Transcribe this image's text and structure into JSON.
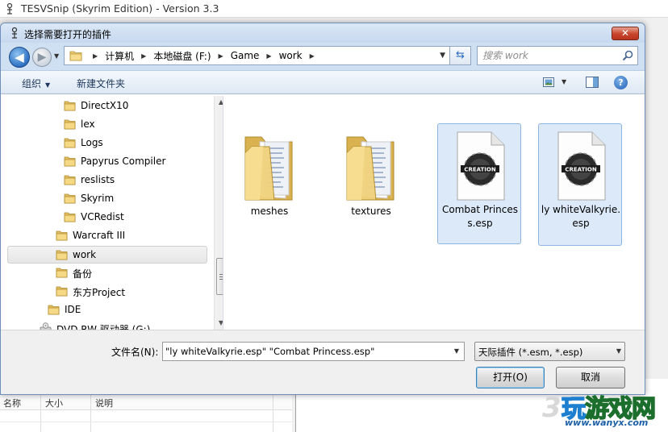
{
  "app": {
    "title": "TESVSnip (Skyrim Edition) - Version 3.3",
    "list_headers": [
      "名称",
      "大小",
      "说明"
    ]
  },
  "dialog": {
    "title": "选择需要打开的插件",
    "close_label": "✕",
    "breadcrumb": [
      "计算机",
      "本地磁盘 (F:)",
      "Game",
      "work"
    ],
    "search_placeholder": "搜索 work",
    "toolbar": {
      "organize_label": "组织",
      "new_folder_label": "新建文件夹"
    },
    "tree": [
      {
        "label": "DirectX10",
        "indent": 2
      },
      {
        "label": "lex",
        "indent": 2
      },
      {
        "label": "Logs",
        "indent": 2
      },
      {
        "label": "Papyrus Compiler",
        "indent": 2
      },
      {
        "label": "reslists",
        "indent": 2
      },
      {
        "label": "Skyrim",
        "indent": 2
      },
      {
        "label": "VCRedist",
        "indent": 2
      },
      {
        "label": "Warcraft III",
        "indent": 1
      },
      {
        "label": "work",
        "indent": 1,
        "selected": true
      },
      {
        "label": "备份",
        "indent": 1
      },
      {
        "label": "东方Project",
        "indent": 1
      },
      {
        "label": "IDE",
        "indent": 0
      },
      {
        "label": "DVD RW 驱动器 (G:)",
        "indent": -1
      }
    ],
    "files": [
      {
        "name": "meshes",
        "type": "folder"
      },
      {
        "name": "textures",
        "type": "folder"
      },
      {
        "name": "Combat Princess.esp",
        "type": "esp",
        "selected": true,
        "badge": "CREATION"
      },
      {
        "name": "ly whiteValkyrie.esp",
        "type": "esp",
        "selected": true,
        "badge": "CREATION"
      }
    ],
    "filename_label": "文件名(N):",
    "filename_value": "\"ly whiteValkyrie.esp\" \"Combat Princess.esp\"",
    "filetype_value": "天际插件 (*.esm, *.esp)",
    "open_button": "打开(O)",
    "cancel_button": "取消"
  },
  "watermark": {
    "number": "3",
    "text_part1": "玩",
    "text_part2": "游戏网",
    "url": "www.wanyx.com"
  },
  "colors": {
    "dialog_frame": "#cfe0f2",
    "selection": "#dbe9f9",
    "close_button": "#c7442b"
  }
}
